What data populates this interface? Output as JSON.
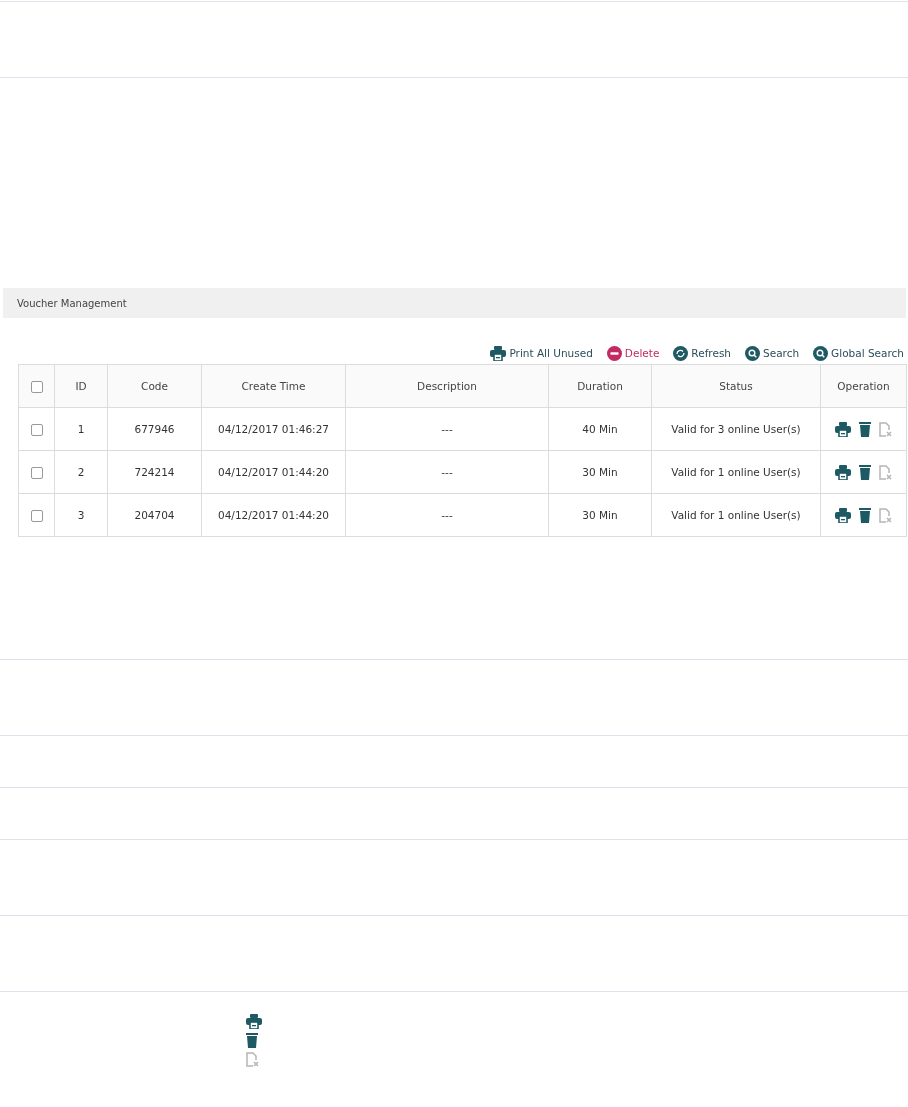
{
  "panel": {
    "title": "Voucher Management"
  },
  "toolbar": [
    {
      "kind": "print",
      "label": "Print All Unused"
    },
    {
      "kind": "delete",
      "label": "Delete"
    },
    {
      "kind": "refresh",
      "label": "Refresh"
    },
    {
      "kind": "search",
      "label": "Search"
    },
    {
      "kind": "search",
      "label": "Global Search"
    }
  ],
  "table": {
    "select_all": {
      "checked": false
    },
    "columns": [
      "ID",
      "Code",
      "Create Time",
      "Description",
      "Duration",
      "Status",
      "Operation"
    ],
    "rows": [
      {
        "selected": false,
        "cells": [
          "1",
          "677946",
          "04/12/2017 01:46:27",
          "---",
          "40 Min",
          "Valid for 3 online User(s)"
        ],
        "operations": [
          {
            "kind": "print",
            "disabled": false
          },
          {
            "kind": "delete",
            "disabled": false
          },
          {
            "kind": "void",
            "disabled": true
          }
        ]
      },
      {
        "selected": false,
        "cells": [
          "2",
          "724214",
          "04/12/2017 01:44:20",
          "---",
          "30 Min",
          "Valid for 1 online User(s)"
        ],
        "operations": [
          {
            "kind": "print",
            "disabled": false
          },
          {
            "kind": "delete",
            "disabled": false
          },
          {
            "kind": "void",
            "disabled": true
          }
        ]
      },
      {
        "selected": false,
        "cells": [
          "3",
          "204704",
          "04/12/2017 01:44:20",
          "---",
          "30 Min",
          "Valid for 1 online User(s)"
        ],
        "operations": [
          {
            "kind": "print",
            "disabled": false
          },
          {
            "kind": "delete",
            "disabled": false
          },
          {
            "kind": "void",
            "disabled": true
          }
        ]
      }
    ]
  },
  "legend_icons": [
    {
      "kind": "print",
      "disabled": false
    },
    {
      "kind": "delete",
      "disabled": false
    },
    {
      "kind": "void",
      "disabled": true
    }
  ]
}
